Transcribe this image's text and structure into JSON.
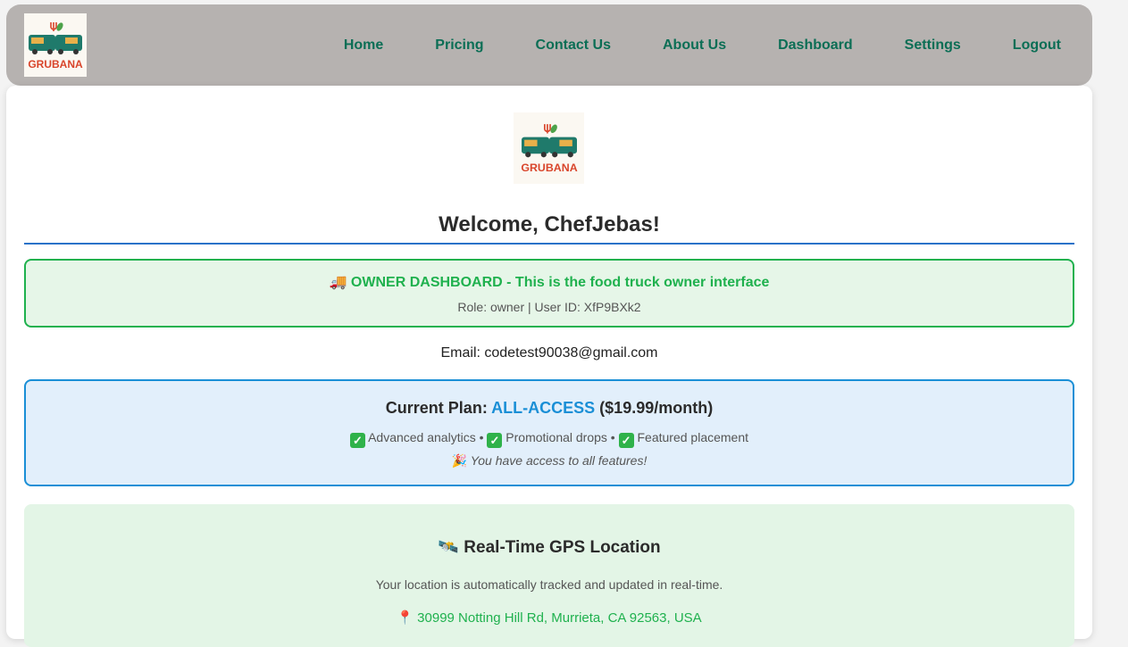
{
  "brand": {
    "name": "GRUBANA"
  },
  "nav": {
    "items": [
      "Home",
      "Pricing",
      "Contact Us",
      "About Us",
      "Dashboard",
      "Settings",
      "Logout"
    ]
  },
  "welcome": {
    "text": "Welcome, ChefJebas!"
  },
  "owner_banner": {
    "title": "🚚 OWNER DASHBOARD - This is the food truck owner interface",
    "meta": "Role: owner | User ID: XfP9BXk2"
  },
  "email": {
    "text": "Email: codetest90038@gmail.com"
  },
  "plan": {
    "label": "Current Plan:",
    "name": "ALL-ACCESS",
    "price": "($19.99/month)",
    "features": [
      "Advanced analytics",
      "Promotional drops",
      "Featured placement"
    ],
    "note": "You have access to all features!",
    "note_icon": "🎉"
  },
  "gps": {
    "title": "🛰️ Real-Time GPS Location",
    "description": "Your location is automatically tracked and updated in real-time.",
    "address": "📍 30999 Notting Hill Rd, Murrieta, CA 92563, USA"
  },
  "colors": {
    "nav_bg": "#b6b2b0",
    "nav_link": "#0b6e55",
    "owner_accent": "#1fb14e",
    "plan_accent": "#1a8fd6",
    "welcome_underline": "#2a72c8"
  }
}
